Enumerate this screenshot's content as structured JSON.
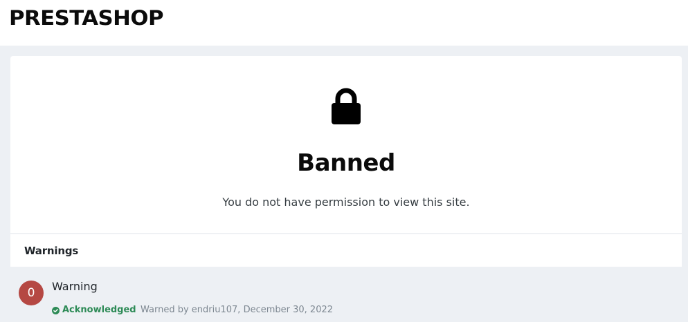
{
  "header": {
    "logo_text": "PRESTASHOP"
  },
  "banned": {
    "icon": "lock-icon",
    "title": "Banned",
    "message": "You do not have permission to view this site."
  },
  "warnings": {
    "section_title": "Warnings",
    "items": [
      {
        "points": "0",
        "title": "Warning",
        "status": "Acknowledged",
        "status_icon": "check-circle-icon",
        "meta": "Warned by endriu107, December 30, 2022"
      }
    ]
  },
  "colors": {
    "page_background": "#edf0f4",
    "card_background": "#ffffff",
    "points_badge": "#b54843",
    "acknowledged": "#2e8b57",
    "meta_text": "#7d8791"
  }
}
